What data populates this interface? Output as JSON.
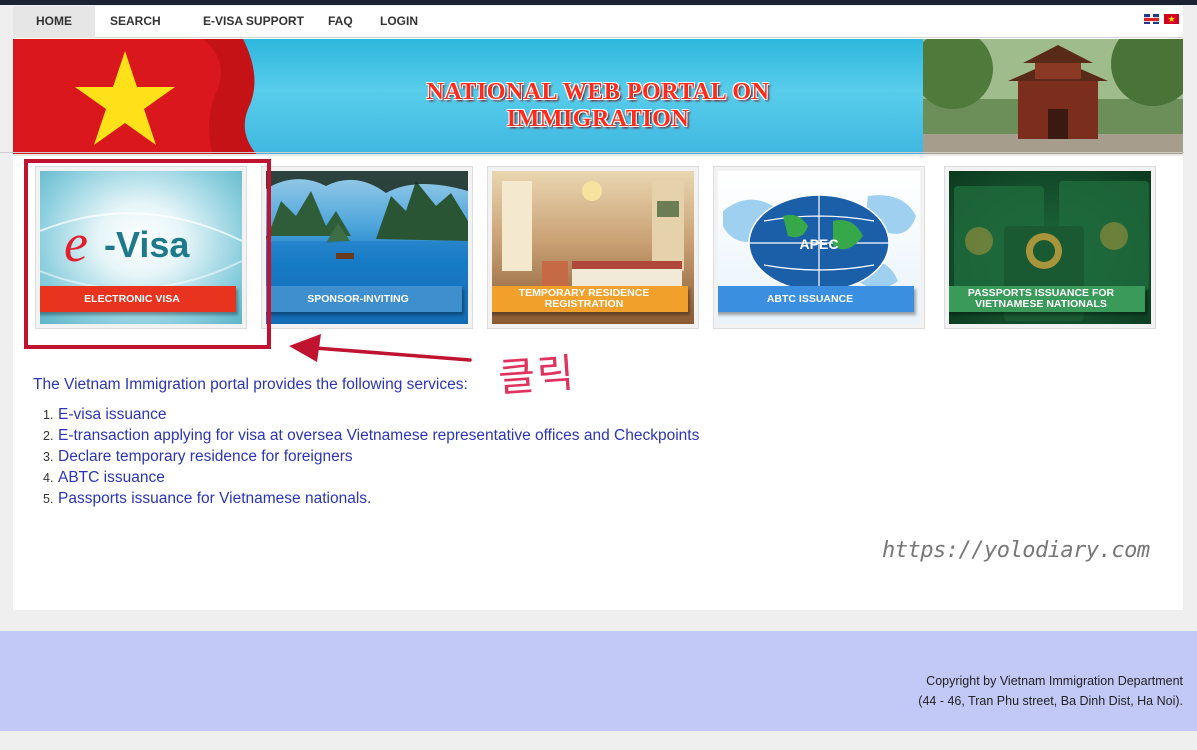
{
  "nav": {
    "items": [
      "HOME",
      "SEARCH",
      "E-VISA SUPPORT",
      "FAQ",
      "LOGIN"
    ],
    "lang_vn_glyph": "★"
  },
  "banner": {
    "title": "NATIONAL WEB PORTAL ON IMMIGRATION"
  },
  "tiles": [
    {
      "label": "ELECTRONIC VISA",
      "image_text": "-Visa",
      "image_letter": "e",
      "color": "#e8331f"
    },
    {
      "label": "SPONSOR-INVITING",
      "color": "#3f8fce"
    },
    {
      "label_line1": "TEMPORARY RESIDENCE",
      "label_line2": "REGISTRATION",
      "color": "#f2a02c"
    },
    {
      "label": "ABTC ISSUANCE",
      "image_text": "APEC",
      "color": "#3a8fe0"
    },
    {
      "label_line1": "PASSPORTS ISSUANCE FOR",
      "label_line2": "VIETNAMESE NATIONALS",
      "color": "#3a9a5a"
    }
  ],
  "annotation": {
    "korean": "클릭",
    "watermark": "https://yolodiary.com",
    "highlight_color": "#c0132f"
  },
  "content": {
    "intro": "The Vietnam Immigration portal provides the following services:",
    "services": [
      "E-visa issuance",
      "E-transaction applying for visa at oversea Vietnamese representative offices and Checkpoints",
      "Declare temporary residence for foreigners",
      "ABTC issuance",
      "Passports issuance for Vietnamese nationals."
    ],
    "service_numbers": [
      "1.",
      "2.",
      "3.",
      "4.",
      "5."
    ]
  },
  "footer": {
    "line1": "Copyright by Vietnam Immigration Department",
    "line2": "(44 - 46, Tran Phu street, Ba Dinh Dist, Ha Noi)."
  }
}
